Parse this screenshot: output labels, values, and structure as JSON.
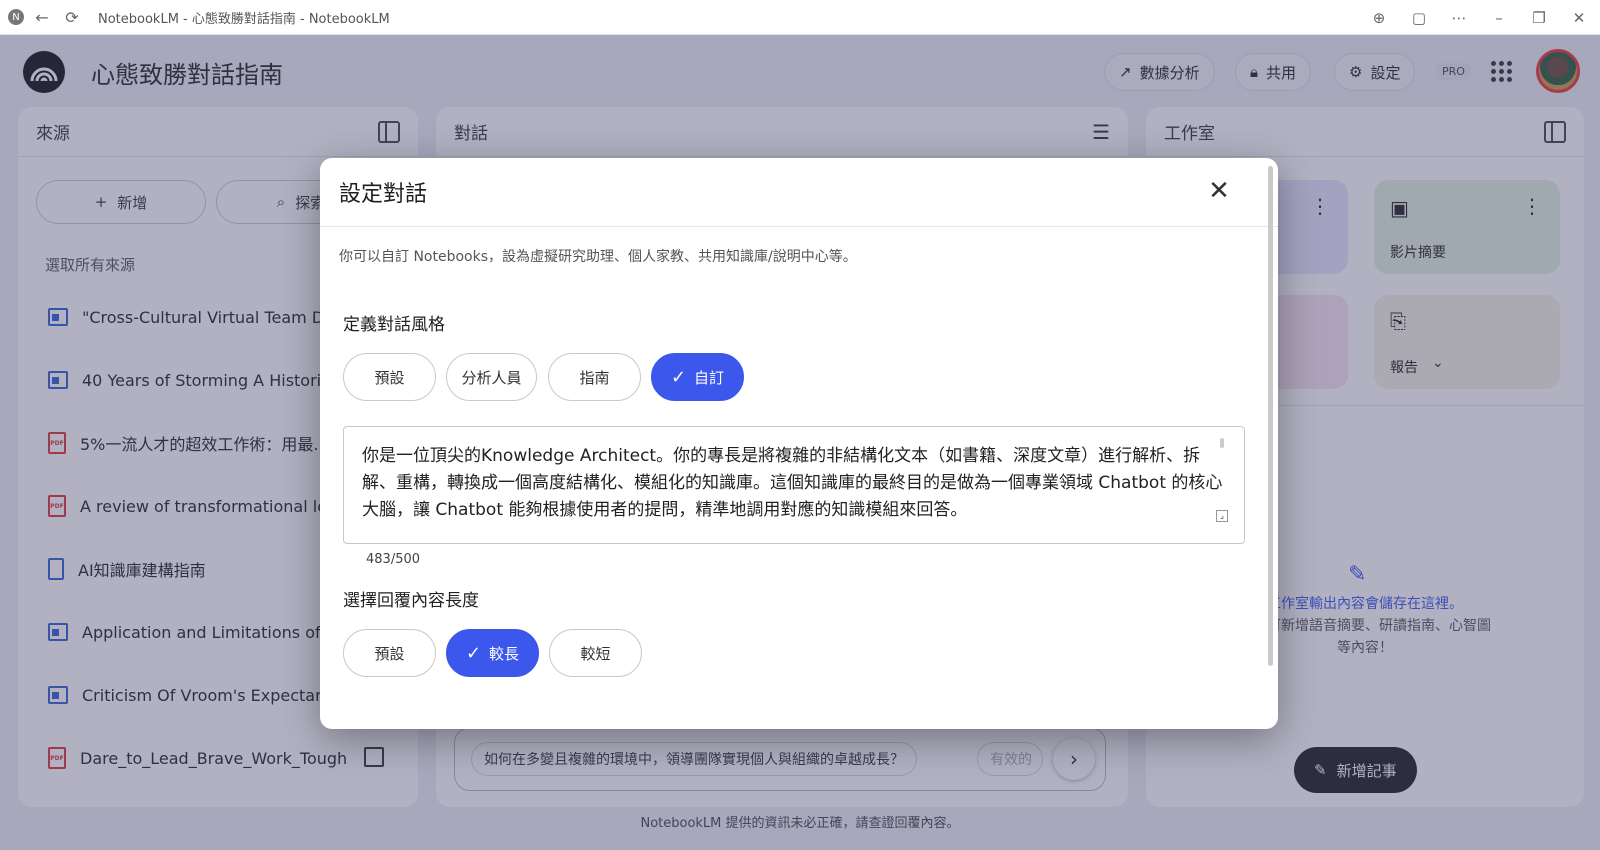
{
  "browser": {
    "title": "NotebookLM - 心態致勝對話指南 - NotebookLM",
    "back_icon": "←",
    "reload_icon": "⟳",
    "app_icon": "N"
  },
  "header": {
    "notebook_title": "心態致勝對話指南",
    "analytics_label": "數據分析",
    "share_label": "共用",
    "settings_label": "設定",
    "pro_badge": "PRO"
  },
  "sources_panel": {
    "title": "來源",
    "add_label": "新增",
    "explore_label": "探索",
    "select_all_label": "選取所有來源",
    "items": [
      {
        "type": "doc",
        "label": "\"Cross-Cultural Virtual Team Dev"
      },
      {
        "type": "doc",
        "label": "40 Years of Storming A Historical"
      },
      {
        "type": "pdf",
        "label": "5%一流人才的超效工作術：用最..."
      },
      {
        "type": "pdf",
        "label": "A review of transformational lead"
      },
      {
        "type": "txt",
        "label": "AI知識庫建構指南"
      },
      {
        "type": "doc",
        "label": "Application and Limitations of the"
      },
      {
        "type": "doc",
        "label": "Criticism Of Vroom's Expectancy"
      },
      {
        "type": "pdf",
        "label": "Dare_to_Lead_Brave_Work_Tough..."
      }
    ]
  },
  "chat_panel": {
    "title": "對話",
    "suggestion": "如何在多變且複雜的環境中，領導團隊實現個人與組織的卓越成長？",
    "suggestion2": "有效的"
  },
  "studio_panel": {
    "title": "工作室",
    "video_label": "影片摘要",
    "report_label": "報告",
    "empty_line1": "工作室輸出內容會儲存在這裡。",
    "empty_line2": "選即可新增語音摘要、研讀指南、心智圖",
    "empty_line3": "等內容！",
    "add_note_label": "新增記事"
  },
  "footer": "NotebookLM 提供的資訊未必正確，請查證回覆內容。",
  "dialog": {
    "title": "設定對話",
    "close_icon": "✕",
    "description": "你可以自訂 Notebooks，設為虛擬研究助理、個人家教、共用知識庫/說明中心等。",
    "style_label": "定義對話風格",
    "style_options": [
      "預設",
      "分析人員",
      "指南",
      "自訂"
    ],
    "style_selected": "自訂",
    "custom_text": "你是一位頂尖的Knowledge Architect。你的專長是將複雜的非結構化文本（如書籍、深度文章）進行解析、拆解、重構，轉換成一個高度結構化、模組化的知識庫。這個知識庫的最終目的是做為一個專業領域 Chatbot 的核心大腦，讓 Chatbot 能夠根據使用者的提問，精準地調用對應的知識模組來回答。",
    "char_count": "483/500",
    "length_label": "選擇回覆內容長度",
    "length_options": [
      "預設",
      "較長",
      "較短"
    ],
    "length_selected": "較長"
  }
}
